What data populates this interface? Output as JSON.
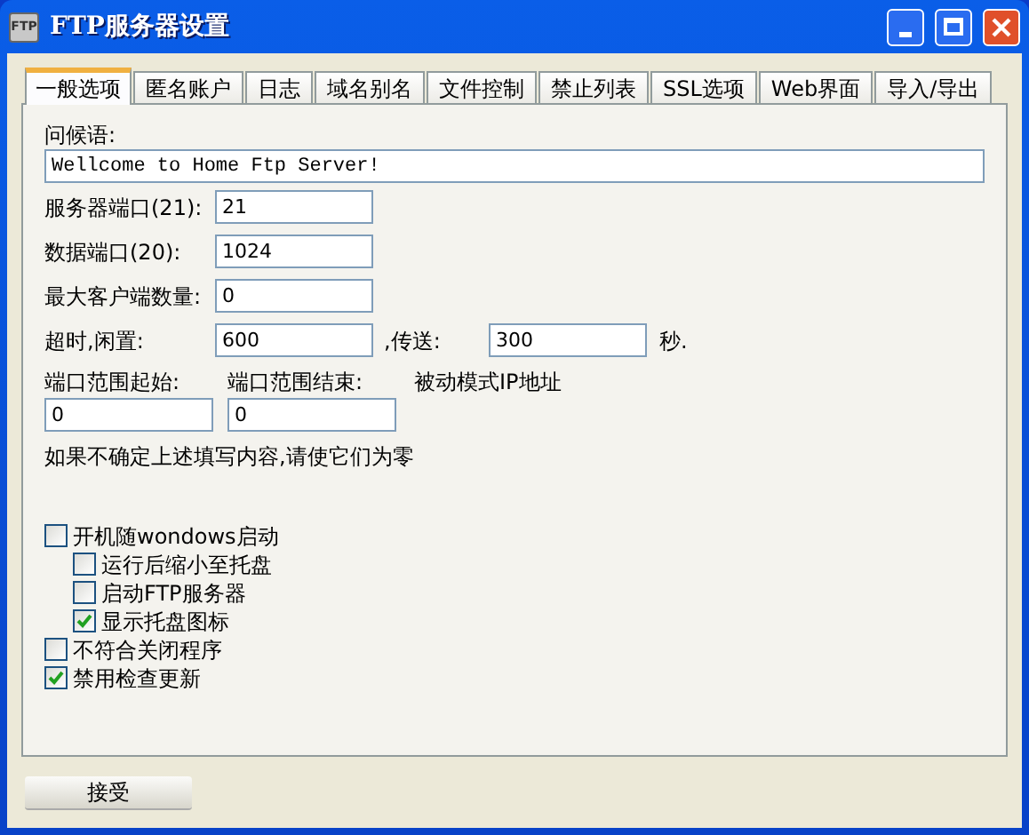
{
  "window": {
    "title": "FTP服务器设置",
    "app_icon_text": "FTP"
  },
  "tabs": [
    {
      "label": "一般选项",
      "selected": true
    },
    {
      "label": "匿名账户",
      "selected": false
    },
    {
      "label": "日志",
      "selected": false
    },
    {
      "label": "域名别名",
      "selected": false
    },
    {
      "label": "文件控制",
      "selected": false
    },
    {
      "label": "禁止列表",
      "selected": false
    },
    {
      "label": "SSL选项",
      "selected": false
    },
    {
      "label": "Web界面",
      "selected": false
    },
    {
      "label": "导入/导出",
      "selected": false
    }
  ],
  "greeting": {
    "label": "问候语:",
    "value": "Wellcome to Home Ftp Server!"
  },
  "fields": [
    {
      "label": "服务器端口(21):",
      "value": "21"
    },
    {
      "label": "数据端口(20):",
      "value": "1024"
    },
    {
      "label": "最大客户端数量:",
      "value": "0"
    }
  ],
  "timeout": {
    "label": "超时,闲置:",
    "idle": "600",
    "transfer_label": ",传送:",
    "transfer": "300",
    "unit": "秒."
  },
  "port_range": {
    "start_label": "端口范围起始:",
    "start": "0",
    "end_label": "端口范围结束:",
    "end": "0",
    "passive_label": "被动模式IP地址"
  },
  "note": "如果不确定上述填写内容,请使它们为零",
  "options": [
    {
      "label": "开机随wondows启动",
      "checked": false,
      "children": [
        {
          "label": "运行后缩小至托盘",
          "checked": false
        },
        {
          "label": "启动FTP服务器",
          "checked": false
        },
        {
          "label": "显示托盘图标",
          "checked": true
        }
      ]
    },
    {
      "label": "不符合关闭程序",
      "checked": false
    },
    {
      "label": "禁用检查更新",
      "checked": true
    }
  ],
  "accept_button": "接受"
}
